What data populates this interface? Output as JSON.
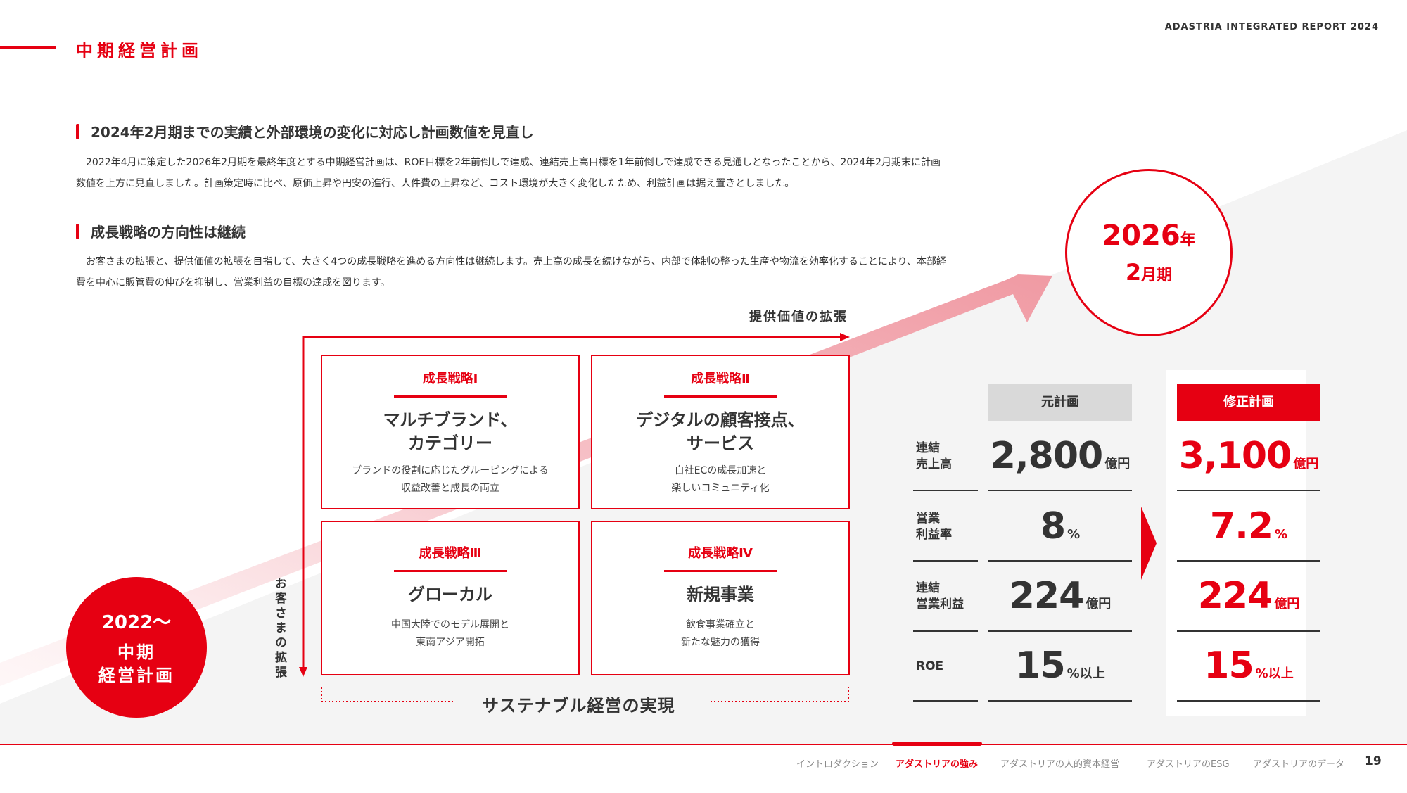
{
  "header": {
    "page_title": "中期経営計画",
    "report_name": "ADASTRIA INTEGRATED REPORT 2024"
  },
  "sections": [
    {
      "heading": "2024年2月期までの実績と外部環境の変化に対応し計画数値を見直し",
      "body": "2022年4月に策定した2026年2月期を最終年度とする中期経営計画は、ROE目標を2年前倒しで達成、連結売上高目標を1年前倒しで達成できる見通しとなったことから、2024年2月期末に計画数値を上方に見直しました。計画策定時に比べ、原価上昇や円安の進行、人件費の上昇など、コスト環境が大きく変化したため、利益計画は据え置きとしました。"
    },
    {
      "heading": "成長戦略の方向性は継続",
      "body": "お客さまの拡張と、提供価値の拡張を目指して、大きく4つの成長戦略を進める方向性は継続します。売上高の成長を続けながら、内部で体制の整った生産や物流を効率化することにより、本部経費を中心に販管費の伸びを抑制し、営業利益の目標の達成を図ります。"
    }
  ],
  "diagram": {
    "axis_horizontal": "提供価値の拡張",
    "axis_vertical": "お客さまの拡張",
    "strategies": [
      {
        "label": "成長戦略Ⅰ",
        "title_lines": [
          "マルチブランド、",
          "カテゴリー"
        ],
        "desc_lines": [
          "ブランドの役割に応じたグルーピングによる",
          "収益改善と成長の両立"
        ]
      },
      {
        "label": "成長戦略Ⅱ",
        "title_lines": [
          "デジタルの顧客接点、",
          "サービス"
        ],
        "desc_lines": [
          "自社ECの成長加速と",
          "楽しいコミュニティ化"
        ]
      },
      {
        "label": "成長戦略Ⅲ",
        "title_lines": [
          "グローカル"
        ],
        "desc_lines": [
          "中国大陸でのモデル展開と",
          "東南アジア開拓"
        ]
      },
      {
        "label": "成長戦略Ⅳ",
        "title_lines": [
          "新規事業"
        ],
        "desc_lines": [
          "飲食事業確立と",
          "新たな魅力の獲得"
        ]
      }
    ],
    "foundation": "サステナブル経営の実現",
    "start_circle": {
      "year": "2022〜",
      "line1": "中期",
      "line2": "経営計画"
    },
    "goal_circle": {
      "year": "2026",
      "year_unit": "年",
      "month": "2",
      "month_unit": "月期"
    }
  },
  "plan_table": {
    "original_header": "元計画",
    "revised_header": "修正計画",
    "rows": [
      {
        "label_lines": [
          "連結",
          "売上高"
        ],
        "original": {
          "value": "2,800",
          "unit": "億円"
        },
        "revised": {
          "value": "3,100",
          "unit": "億円"
        }
      },
      {
        "label_lines": [
          "営業",
          "利益率"
        ],
        "original": {
          "value": "8",
          "unit": "%"
        },
        "revised": {
          "value": "7.2",
          "unit": "%"
        }
      },
      {
        "label_lines": [
          "連結",
          "営業利益"
        ],
        "original": {
          "value": "224",
          "unit": "億円"
        },
        "revised": {
          "value": "224",
          "unit": "億円"
        }
      },
      {
        "label_lines": [
          "ROE"
        ],
        "original": {
          "value": "15",
          "unit": "%以上"
        },
        "revised": {
          "value": "15",
          "unit": "%以上"
        }
      }
    ]
  },
  "footer": {
    "nav": [
      {
        "label": "イントロダクション",
        "active": false
      },
      {
        "label": "アダストリアの強み",
        "active": true
      },
      {
        "label": "アダストリアの人的資本経営",
        "active": false
      },
      {
        "label": "アダストリアのESG",
        "active": false
      },
      {
        "label": "アダストリアのデータ",
        "active": false
      }
    ],
    "page_number": "19"
  },
  "colors": {
    "accent": "#e60012",
    "text": "#333333",
    "panel_gray": "#f4f4f4",
    "header_gray": "#d9d9d9"
  }
}
